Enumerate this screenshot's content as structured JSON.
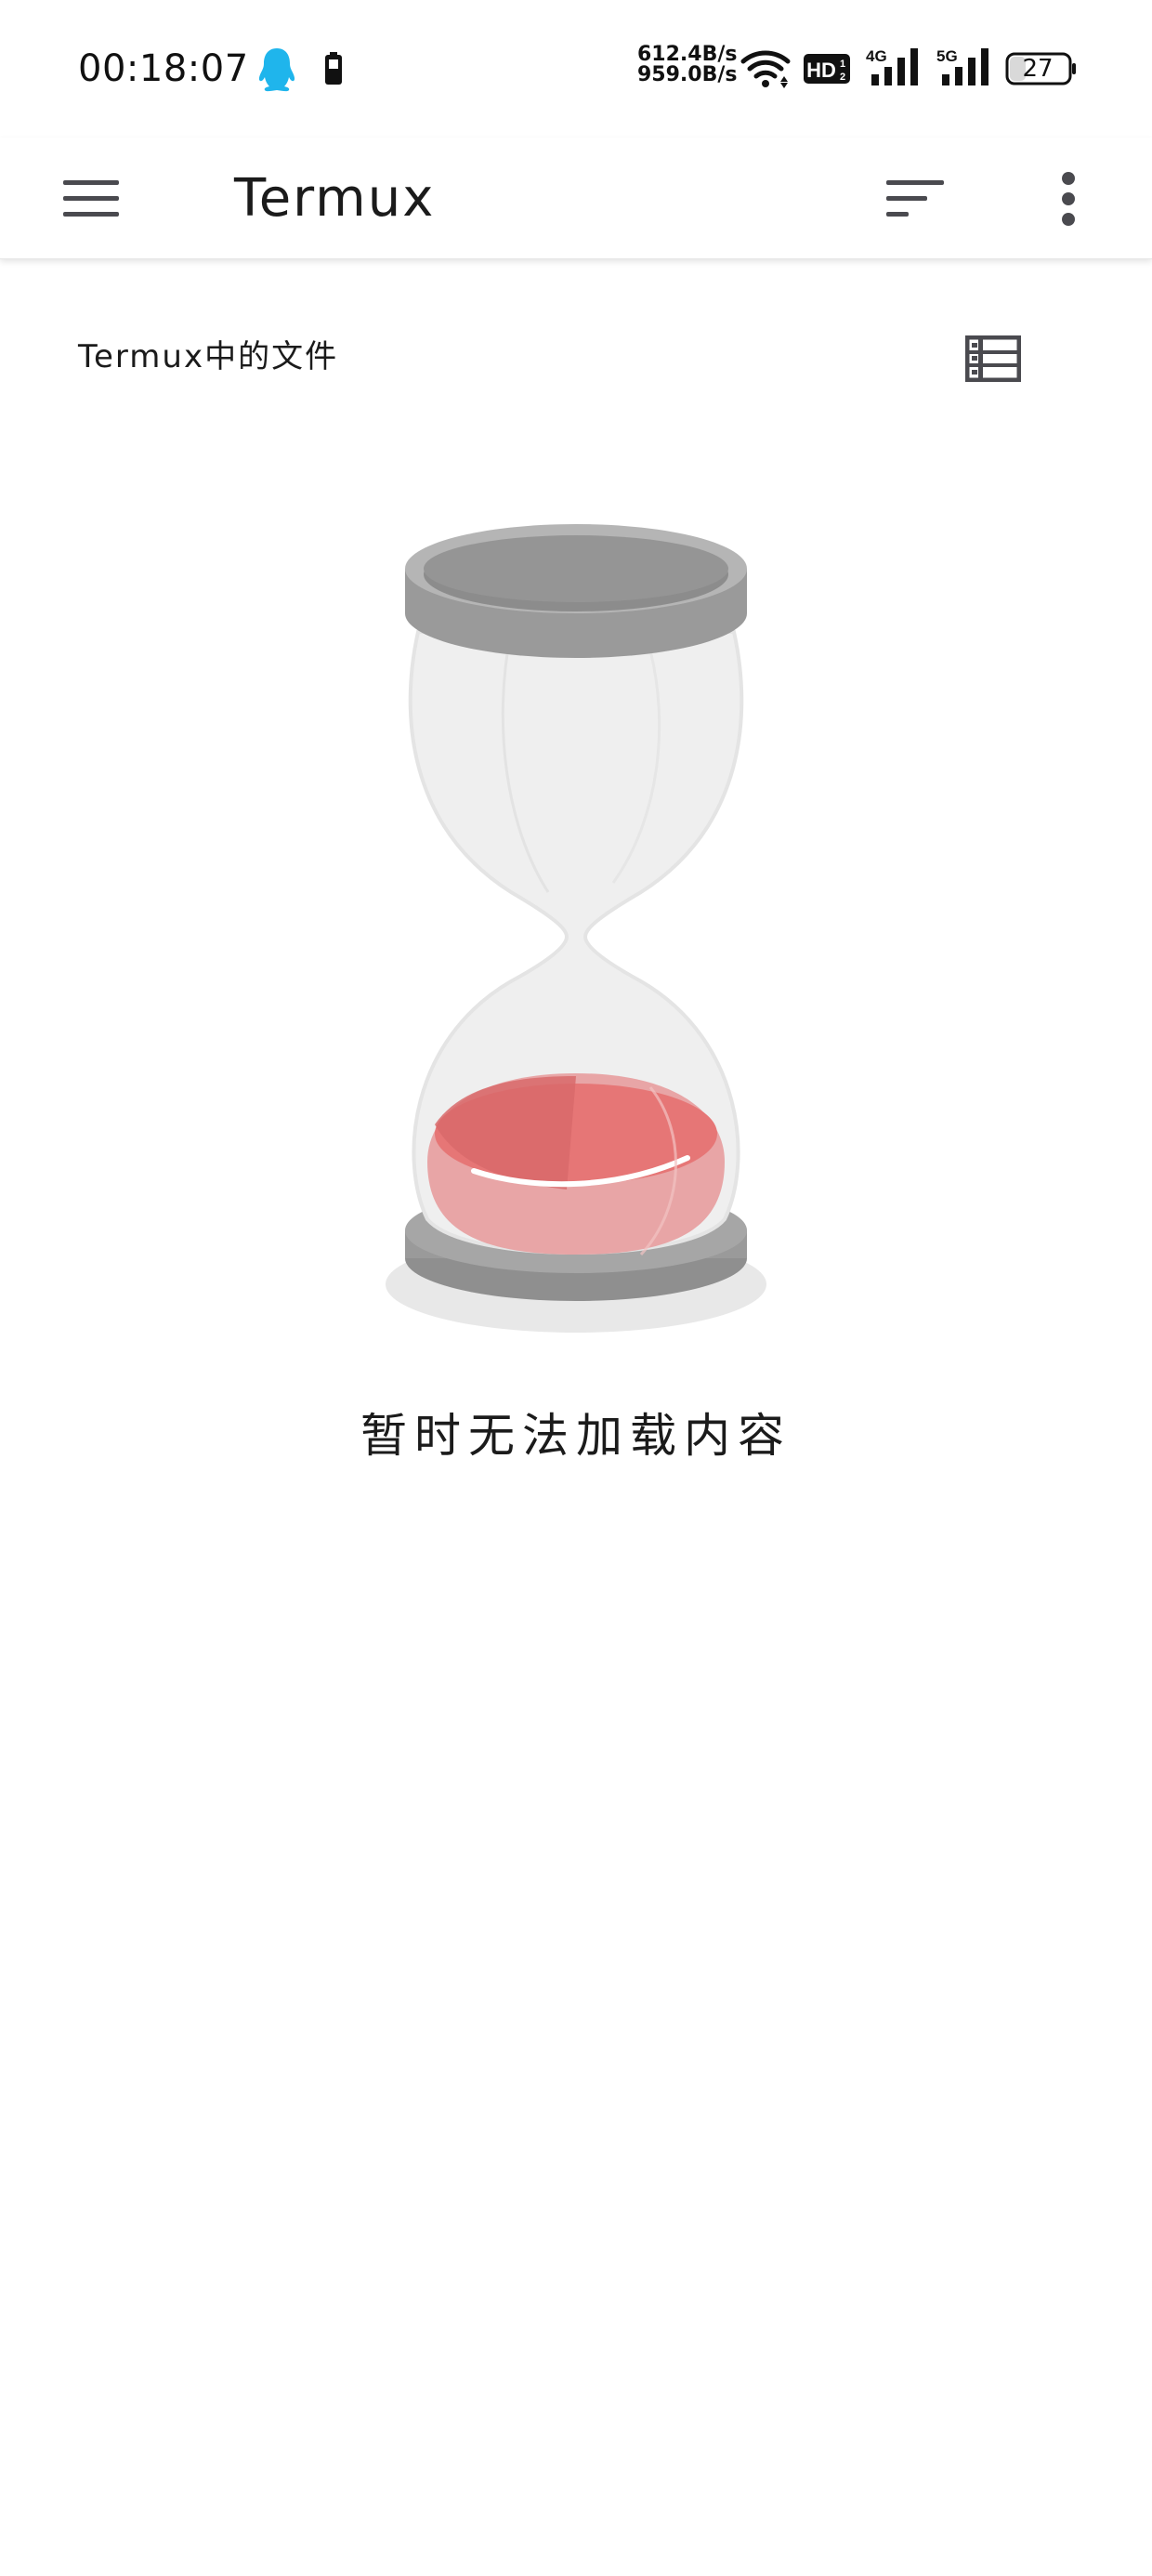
{
  "status_bar": {
    "time": "00:18:07",
    "upload_speed": "612.4B/s",
    "download_speed": "959.0B/s",
    "hd_label": "HD",
    "network_4g": "4G",
    "network_5g": "5G",
    "battery_level": "27"
  },
  "app_bar": {
    "title": "Termux"
  },
  "section": {
    "title": "Termux中的文件"
  },
  "empty_state": {
    "message": "暂时无法加载内容"
  },
  "colors": {
    "text": "#1b1b1b",
    "icon": "#4a4a4f",
    "qq_icon": "#1fb5ec",
    "hourglass_sand": "#e67676",
    "hourglass_base": "#8f8f8f"
  }
}
